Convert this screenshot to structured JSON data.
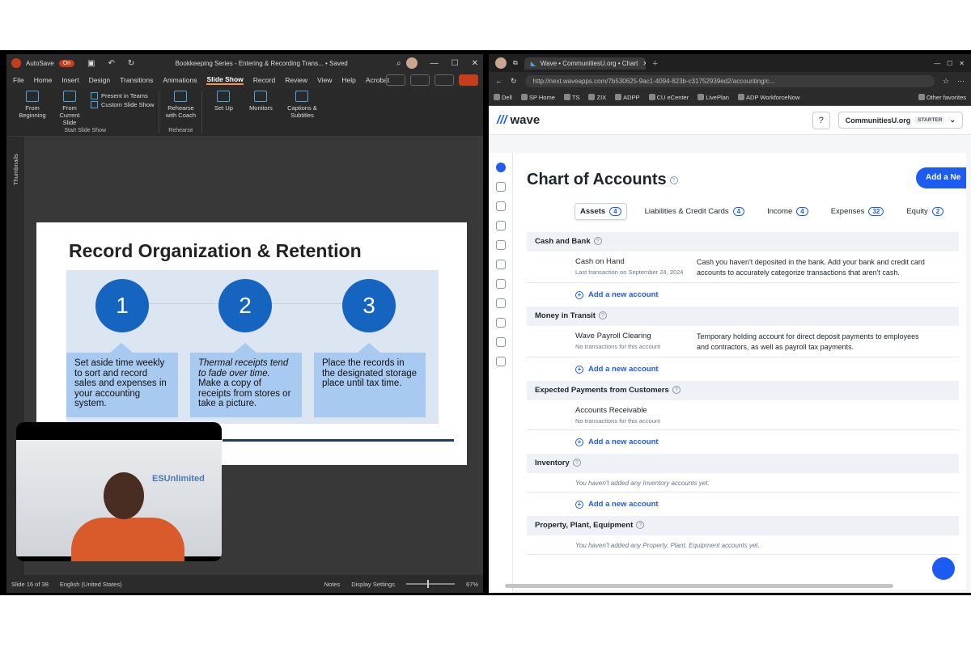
{
  "ppt": {
    "autosave_label": "AutoSave",
    "autosave_state": "On",
    "doc_title": "Bookkeeping Series - Entering & Recording Trans... • Saved",
    "tabs": [
      "File",
      "Home",
      "Insert",
      "Design",
      "Transitions",
      "Animations",
      "Slide Show",
      "Record",
      "Review",
      "View",
      "Help",
      "Acrobat"
    ],
    "active_tab": "Slide Show",
    "ribbon": {
      "from_beginning": "From Beginning",
      "from_current": "From Current Slide",
      "present_teams": "Present in Teams",
      "custom_show": "Custom Slide Show",
      "group_start": "Start Slide Show",
      "rehearse": "Rehearse with Coach",
      "group_rehearse": "Rehearse",
      "setup": "Set Up",
      "monitors": "Monitors",
      "captions": "Captions & Subtitles"
    },
    "thumbnails_label": "Thumbnails",
    "slide": {
      "title": "Record Organization & Retention",
      "steps": [
        {
          "num": "1",
          "text": "Set aside time weekly to sort and record sales and expenses in your accounting system."
        },
        {
          "num": "2",
          "italic": "Thermal receipts tend to fade over time.",
          "text": " Make a copy of receipts from stores or take a picture."
        },
        {
          "num": "3",
          "text": "Place the records in the designated storage place until tax time."
        }
      ]
    },
    "video_wall_text": "ESUnlimited",
    "status": {
      "slide": "Slide 16 of 38",
      "language": "English (United States)",
      "notes": "Notes",
      "display": "Display Settings",
      "zoom": "67%"
    }
  },
  "edge": {
    "tab_title": "Wave • CommunitiesU.org • Chart",
    "url": "http://next.waveapps.com/7b530625-9ac1-4094-823b-c31752939ed2/accounting/c...",
    "favorites": [
      "Dell",
      "SP Home",
      "TS",
      "ZIX",
      "ADPP",
      "CU eCenter",
      "LivePlan",
      "ADP WorkforceNow",
      "Other favorites"
    ]
  },
  "wave": {
    "logo": "wave",
    "business": "CommunitiesU.org",
    "plan": "STARTER",
    "page_title": "Chart of Accounts",
    "add_button": "Add a Ne",
    "tabs": [
      {
        "label": "Assets",
        "count": "4"
      },
      {
        "label": "Liabilities & Credit Cards",
        "count": "4"
      },
      {
        "label": "Income",
        "count": "4"
      },
      {
        "label": "Expenses",
        "count": "32"
      },
      {
        "label": "Equity",
        "count": "2"
      }
    ],
    "add_account": "Add a new account",
    "sections": {
      "cash": {
        "title": "Cash and Bank",
        "name": "Cash on Hand",
        "sub": "Last transaction on September 24, 2024",
        "desc": "Cash you haven't deposited in the bank. Add your bank and credit card accounts to accurately categorize transactions that aren't cash."
      },
      "transit": {
        "title": "Money in Transit",
        "name": "Wave Payroll Clearing",
        "sub": "No transactions for this account",
        "desc": "Temporary holding account for direct deposit payments to employees and contractors, as well as payroll tax payments."
      },
      "expected": {
        "title": "Expected Payments from Customers",
        "name": "Accounts Receivable",
        "sub": "No transactions for this account"
      },
      "inventory": {
        "title": "Inventory",
        "empty": "You haven't added any Inventory accounts yet."
      },
      "ppe": {
        "title": "Property, Plant, Equipment",
        "empty": "You haven't added any Property, Plant, Equipment accounts yet."
      }
    }
  }
}
